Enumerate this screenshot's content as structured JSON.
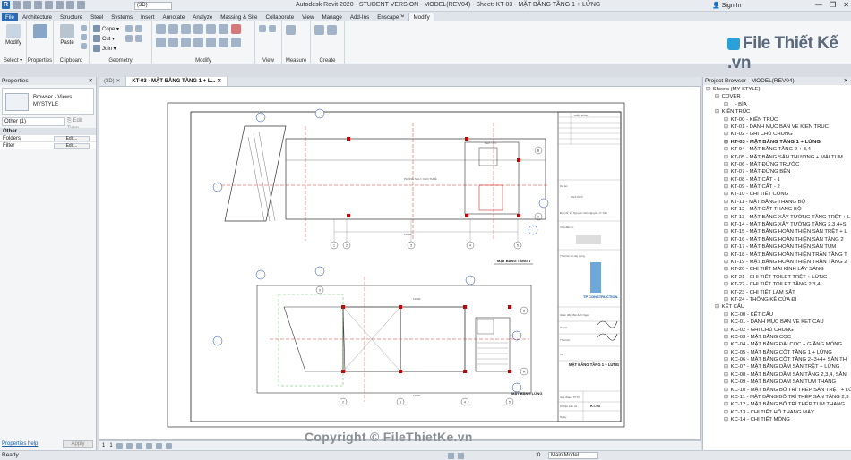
{
  "title": "Autodesk Revit 2020 - STUDENT VERSION - MODEL(REV04) - Sheet: KT-03 - MẶT BẰNG TẦNG 1 + LỬNG",
  "sign_in": "Sign In",
  "view_selector": "(3D)",
  "ribbon_tabs": [
    "File",
    "Architecture",
    "Structure",
    "Steel",
    "Systems",
    "Insert",
    "Annotate",
    "Analyze",
    "Massing & Site",
    "Collaborate",
    "View",
    "Manage",
    "Add-Ins",
    "Enscape™",
    "Modify"
  ],
  "active_tab": "Modify",
  "ribbon": {
    "modify": "Modify",
    "select": "Select ▾",
    "properties": "Properties",
    "paste": "Paste",
    "clipboard": "Clipboard",
    "cope": "Cope ▾",
    "cut": "Cut ▾",
    "join": "Join ▾",
    "geometry": "Geometry",
    "modify_panel": "Modify",
    "view_panel": "View",
    "measure_panel": "Measure",
    "create_panel": "Create"
  },
  "brand": "File Thiết Kế .vn",
  "properties": {
    "header": "Properties",
    "type_line1": "Browser - Views",
    "type_line2": "MYSTYLE",
    "selector": "Other (1)",
    "edit_type": "Edit Type",
    "group": "Other",
    "rows": [
      {
        "label": "Folders",
        "button": "Edit..."
      },
      {
        "label": "Filter",
        "button": "Edit..."
      }
    ],
    "help": "Properties help",
    "apply": "Apply"
  },
  "view_tabs": [
    {
      "label": "(3D)",
      "active": false
    },
    {
      "label": "KT-03 - MẶT BẰNG TẦNG 1 + L...",
      "active": true
    }
  ],
  "view_scale": "1 : 1",
  "sheet": {
    "plan1_title": "MẶT BẰNG TẦNG 1",
    "plan2_title": "MẶT BẰNG LỬNG",
    "sheet_title": "MẶT BẰNG TẦNG 1 + LỬNG",
    "company": "TP CONSTRUCTION",
    "sheet_no": "KT-03",
    "grid_labels": [
      "1",
      "2",
      "3",
      "4",
      "5"
    ]
  },
  "watermark": "Copyright © FileThietKe.vn",
  "project_browser": {
    "header": "Project Browser - MODEL(REV04)",
    "items": [
      {
        "indent": 0,
        "toggle": "⊟",
        "label": "Sheets (MY STYLE)",
        "sel": false
      },
      {
        "indent": 1,
        "toggle": "⊟",
        "label": "COVER",
        "sel": false
      },
      {
        "indent": 2,
        "toggle": "⊞",
        "label": "_ - BÌA",
        "sel": false
      },
      {
        "indent": 1,
        "toggle": "⊟",
        "label": "KIẾN TRÚC",
        "sel": false
      },
      {
        "indent": 2,
        "toggle": "⊞",
        "label": "KT-00 - KIẾN TRÚC",
        "sel": false
      },
      {
        "indent": 2,
        "toggle": "⊞",
        "label": "KT-01 - DANH MỤC BẢN VẼ KIẾN TRÚC",
        "sel": false
      },
      {
        "indent": 2,
        "toggle": "⊞",
        "label": "KT-02 - GHI CHÚ CHUNG",
        "sel": false
      },
      {
        "indent": 2,
        "toggle": "⊞",
        "label": "KT-03 - MẶT BẰNG TẦNG 1 + LỬNG",
        "sel": true
      },
      {
        "indent": 2,
        "toggle": "⊞",
        "label": "KT-04 - MẶT BẰNG TẦNG 2 + 3,4",
        "sel": false
      },
      {
        "indent": 2,
        "toggle": "⊞",
        "label": "KT-05 - MẶT BẰNG SÂN THƯỢNG + MÁI TUM",
        "sel": false
      },
      {
        "indent": 2,
        "toggle": "⊞",
        "label": "KT-06 - MẶT ĐỨNG TRƯỚC",
        "sel": false
      },
      {
        "indent": 2,
        "toggle": "⊞",
        "label": "KT-07 - MẶT ĐỨNG BÊN",
        "sel": false
      },
      {
        "indent": 2,
        "toggle": "⊞",
        "label": "KT-08 - MẶT CẮT - 1",
        "sel": false
      },
      {
        "indent": 2,
        "toggle": "⊞",
        "label": "KT-09 - MẶT CẮT - 2",
        "sel": false
      },
      {
        "indent": 2,
        "toggle": "⊞",
        "label": "KT-10 - CHI TIẾT CỔNG",
        "sel": false
      },
      {
        "indent": 2,
        "toggle": "⊞",
        "label": "KT-11 - MẶT BẰNG THANG BỘ",
        "sel": false
      },
      {
        "indent": 2,
        "toggle": "⊞",
        "label": "KT-12 - MẶT CẮT THANG BỘ",
        "sel": false
      },
      {
        "indent": 2,
        "toggle": "⊞",
        "label": "KT-13 - MẶT BẰNG XÂY TƯỜNG TẦNG TRỆT + L",
        "sel": false
      },
      {
        "indent": 2,
        "toggle": "⊞",
        "label": "KT-14 - MẶT BẰNG XÂY TƯỜNG TẦNG 2,3,4+S",
        "sel": false
      },
      {
        "indent": 2,
        "toggle": "⊞",
        "label": "KT-15 - MẶT BẰNG HOÀN THIỆN SÀN TRỆT + L",
        "sel": false
      },
      {
        "indent": 2,
        "toggle": "⊞",
        "label": "KT-16 - MẶT BẰNG HOÀN THIỆN SÀN TẦNG 2",
        "sel": false
      },
      {
        "indent": 2,
        "toggle": "⊞",
        "label": "KT-17 - MẶT BẰNG HOÀN THIỆN SÀN TUM",
        "sel": false
      },
      {
        "indent": 2,
        "toggle": "⊞",
        "label": "KT-18 - MẶT BẰNG HOÀN THIỆN TRẦN TẦNG T",
        "sel": false
      },
      {
        "indent": 2,
        "toggle": "⊞",
        "label": "KT-19 - MẶT BẰNG HOÀN THIỆN TRẦN TẦNG 2",
        "sel": false
      },
      {
        "indent": 2,
        "toggle": "⊞",
        "label": "KT-20 - CHI TIẾT MÁI KÍNH LẤY SÁNG",
        "sel": false
      },
      {
        "indent": 2,
        "toggle": "⊞",
        "label": "KT-21 - CHI TIẾT TOILET TRỆT + LỬNG",
        "sel": false
      },
      {
        "indent": 2,
        "toggle": "⊞",
        "label": "KT-22 - CHI TIẾT TOILET TẦNG 2,3,4",
        "sel": false
      },
      {
        "indent": 2,
        "toggle": "⊞",
        "label": "KT-23 - CHI TIẾT LAM SẮT",
        "sel": false
      },
      {
        "indent": 2,
        "toggle": "⊞",
        "label": "KT-24 - THỐNG KÊ CỬA ĐI",
        "sel": false
      },
      {
        "indent": 1,
        "toggle": "⊟",
        "label": "KẾT CẤU",
        "sel": false
      },
      {
        "indent": 2,
        "toggle": "⊞",
        "label": "KC-00 - KẾT CẤU",
        "sel": false
      },
      {
        "indent": 2,
        "toggle": "⊞",
        "label": "KC-01 - DANH MỤC BẢN VẼ KẾT CẤU",
        "sel": false
      },
      {
        "indent": 2,
        "toggle": "⊞",
        "label": "KC-02 - GHI CHÚ CHUNG",
        "sel": false
      },
      {
        "indent": 2,
        "toggle": "⊞",
        "label": "KC-03 - MẶT BẰNG CỌC",
        "sel": false
      },
      {
        "indent": 2,
        "toggle": "⊞",
        "label": "KC-04 - MẶT BẰNG ĐÀI CỌC + GIẰNG MÓNG",
        "sel": false
      },
      {
        "indent": 2,
        "toggle": "⊞",
        "label": "KC-05 - MẶT BẰNG CỘT TẦNG 1 + LỬNG",
        "sel": false
      },
      {
        "indent": 2,
        "toggle": "⊞",
        "label": "KC-06 - MẶT BẰNG CỘT TẦNG 2+3+4+ SÂN TH",
        "sel": false
      },
      {
        "indent": 2,
        "toggle": "⊞",
        "label": "KC-07 - MẶT BẰNG DẦM SÀN TRỆT + LỬNG",
        "sel": false
      },
      {
        "indent": 2,
        "toggle": "⊞",
        "label": "KC-08 - MẶT BẰNG DẦM SÀN TẦNG 2,3,4, SÂN",
        "sel": false
      },
      {
        "indent": 2,
        "toggle": "⊞",
        "label": "KC-09 - MẶT BẰNG DẦM SÀN TUM THANG",
        "sel": false
      },
      {
        "indent": 2,
        "toggle": "⊞",
        "label": "KC-10 - MẶT BẰNG BỐ TRÍ THÉP SÀN TRỆT + LỬ",
        "sel": false
      },
      {
        "indent": 2,
        "toggle": "⊞",
        "label": "KC-11 - MẶT BẰNG BỐ TRÍ THÉP SÀN TẦNG 2,3",
        "sel": false
      },
      {
        "indent": 2,
        "toggle": "⊞",
        "label": "KC-12 - MẶT BẰNG BỐ TRÍ THÉP TUM THANG",
        "sel": false
      },
      {
        "indent": 2,
        "toggle": "⊞",
        "label": "KC-13 - CHI TIẾT HỐ THANG MÁY",
        "sel": false
      },
      {
        "indent": 2,
        "toggle": "⊞",
        "label": "KC-14 - CHI TIẾT MÓNG",
        "sel": false
      }
    ]
  },
  "status": {
    "ready": "Ready",
    "zero": ":0",
    "model": "Main Model"
  }
}
